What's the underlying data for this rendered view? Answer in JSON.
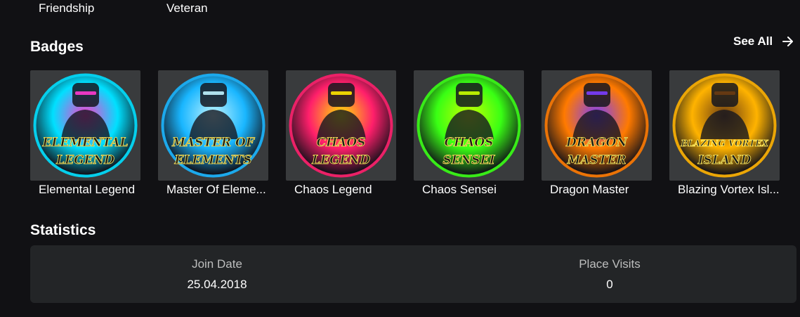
{
  "top_labels": [
    "Friendship",
    "Veteran"
  ],
  "badges_section": {
    "title": "Badges",
    "see_all_label": "See All",
    "see_all_icon": "arrow-right-icon",
    "items": [
      {
        "name": "Elemental Legend",
        "art_top": "ELEMENTAL",
        "art_bottom": "LEGEND",
        "ring": "#00e0ff",
        "accent": "#ff3ad0"
      },
      {
        "name": "Master Of Eleme...",
        "art_top": "MASTER OF",
        "art_bottom": "ELEMENTS",
        "ring": "#19b6ff",
        "accent": "#bff4ff"
      },
      {
        "name": "Chaos Legend",
        "art_top": "CHAOS",
        "art_bottom": "LEGEND",
        "ring": "#ff1f6b",
        "accent": "#ffe600"
      },
      {
        "name": "Chaos Sensei",
        "art_top": "CHAOS",
        "art_bottom": "SENSEI",
        "ring": "#39ff14",
        "accent": "#c8ff00"
      },
      {
        "name": "Dragon Master",
        "art_top": "DRAGON",
        "art_bottom": "MASTER",
        "ring": "#ff7a00",
        "accent": "#7b3dff"
      },
      {
        "name": "Blazing Vortex Isl...",
        "art_top": "BLAZING VORTEX",
        "art_bottom": "ISLAND",
        "ring": "#ffb300",
        "accent": "#6a3b12"
      }
    ]
  },
  "statistics": {
    "title": "Statistics",
    "items": [
      {
        "label": "Join Date",
        "value": "25.04.2018"
      },
      {
        "label": "Place Visits",
        "value": "0"
      }
    ]
  },
  "colors": {
    "background": "#111114",
    "panel": "#232527",
    "tile": "#393b3d",
    "label_muted": "#bdbebe"
  }
}
